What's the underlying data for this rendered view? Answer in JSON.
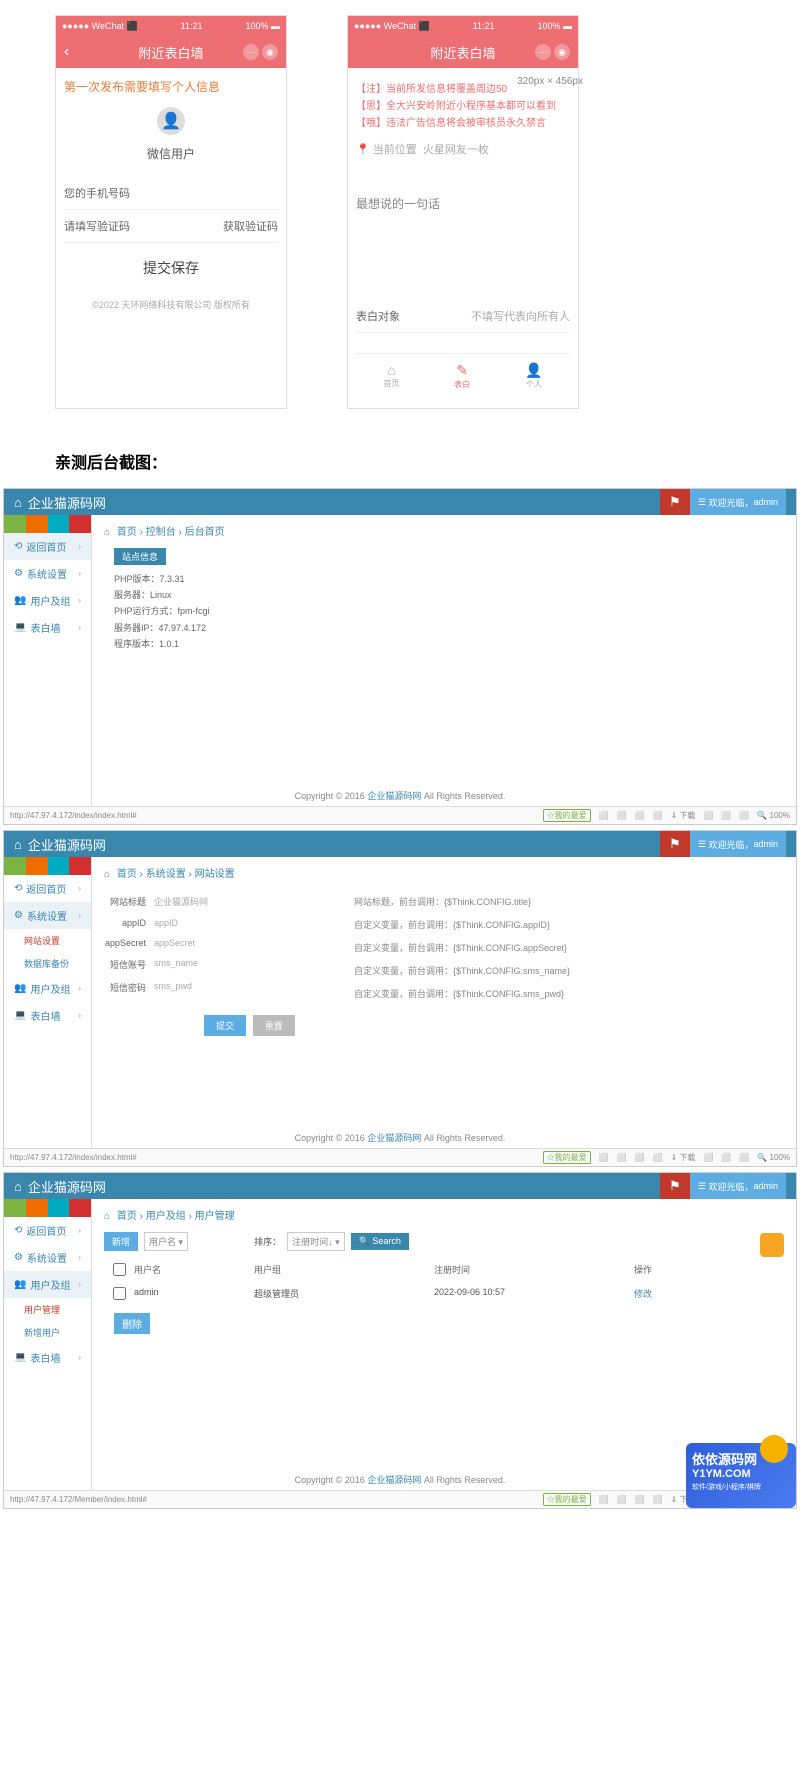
{
  "mobile_status": {
    "carrier": "●●●●● WeChat",
    "signal": "⬛",
    "time": "11:21",
    "battery": "100%",
    "icon": "▬"
  },
  "mobile_header": {
    "title": "附近表白墙",
    "back": "‹"
  },
  "mobile1": {
    "notice": "第一次发布需要填写个人信息",
    "avatar": "👤",
    "username": "微信用户",
    "phone_label": "您的手机号码",
    "code_label": "请填写验证码",
    "code_btn": "获取验证码",
    "submit": "提交保存",
    "copyright": "©2022 天环网络科技有限公司 版权所有"
  },
  "mobile2": {
    "dimension": "320px × 456px",
    "notes": [
      {
        "tag": "【注】",
        "txt": "当前所发信息将覆盖周边50"
      },
      {
        "tag": "【思】",
        "txt": "全大兴安岭附近小程序基本都可以看到"
      },
      {
        "tag": "【哦】",
        "txt": "违法广告信息将会被审核员永久禁言"
      }
    ],
    "loc_icon": "📍",
    "loc_label": "当前位置",
    "loc_val": "火星网友一枚",
    "say_label": "最想说的一句话",
    "target_label": "表白对象",
    "target_placeholder": "不填写代表向所有人",
    "tabs": [
      {
        "icon": "⌂",
        "label": "首页"
      },
      {
        "icon": "✎",
        "label": "表白"
      },
      {
        "icon": "👤",
        "label": "个人"
      }
    ]
  },
  "section_title": "亲测后台截图：",
  "admin_common": {
    "brand": "企业猫源码网",
    "brand_icon": "⌂",
    "user_welcome": "欢迎光临，",
    "user_name": "admin",
    "user_icon": "☰",
    "footer_pre": "Copyright © 2016 ",
    "footer_link": "企业猫源码网",
    "footer_post": " All Rights Reserved.",
    "fav": "☆我的最爱",
    "tools": [
      "⬜",
      "⬜",
      "⬜",
      "⬜",
      "⇓ 下载",
      "⬜",
      "⬜",
      "⬜",
      "🔍 100%"
    ]
  },
  "admin1": {
    "url": "http://47.97.4.172/index/index.html#",
    "crumb": [
      "首页",
      "控制台",
      "后台首页"
    ],
    "card_tag": "站点信息",
    "info": [
      "PHP版本：7.3.31",
      "服务器：Linux",
      "PHP运行方式：fpm-fcgi",
      "服务器IP：47.97.4.172",
      "程序版本：1.0.1"
    ],
    "menu": [
      {
        "label": "返回首页",
        "icon": "⟲",
        "active": true
      },
      {
        "label": "系统设置",
        "icon": "⚙"
      },
      {
        "label": "用户及组",
        "icon": "👥"
      },
      {
        "label": "表白墙",
        "icon": "💻"
      }
    ]
  },
  "admin2": {
    "url": "http://47.97.4.172/index/index.html#",
    "crumb": [
      "首页",
      "系统设置",
      "网站设置"
    ],
    "menu": [
      {
        "label": "返回首页",
        "icon": "⟲"
      },
      {
        "label": "系统设置",
        "icon": "⚙",
        "active": true,
        "subs": [
          "网站设置",
          "数据库备份"
        ]
      },
      {
        "label": "用户及组",
        "icon": "👥"
      },
      {
        "label": "表白墙",
        "icon": "💻"
      }
    ],
    "fields_left": [
      {
        "lbl": "网站标题",
        "val": "企业猫源码网"
      },
      {
        "lbl": "appID",
        "val": "appID"
      },
      {
        "lbl": "appSecret",
        "val": "appSecret"
      },
      {
        "lbl": "短信账号",
        "val": "sms_name"
      },
      {
        "lbl": "短信密码",
        "val": "sms_pwd"
      }
    ],
    "fields_right": [
      {
        "lbl": "网站标题，前台调用：{$Think.CONFIG.title}"
      },
      {
        "lbl": "自定义变量，前台调用：{$Think.CONFIG.appID}"
      },
      {
        "lbl": "自定义变量，前台调用：{$Think.CONFIG.appSecret}"
      },
      {
        "lbl": "自定义变量，前台调用：{$Think.CONFIG.sms_name}"
      },
      {
        "lbl": "自定义变量，前台调用：{$Think.CONFIG.sms_pwd}"
      }
    ],
    "btn_submit": "提交",
    "btn_reset": "重置"
  },
  "admin3": {
    "url": "http://47.97.4.172/Member/index.html#",
    "crumb": [
      "首页",
      "用户及组",
      "用户管理"
    ],
    "menu": [
      {
        "label": "返回首页",
        "icon": "⟲"
      },
      {
        "label": "系统设置",
        "icon": "⚙"
      },
      {
        "label": "用户及组",
        "icon": "👥",
        "active": true,
        "subs": [
          "用户管理",
          "新增用户"
        ]
      },
      {
        "label": "表白墙",
        "icon": "💻"
      }
    ],
    "toolbar": {
      "add": "新增",
      "sel1": "用户名",
      "sort_lbl": "排序：",
      "sel2": "注册时间↓",
      "search": "🔍 Search"
    },
    "thead": [
      "",
      "用户名",
      "用户组",
      "注册时间",
      "操作"
    ],
    "row": {
      "name": "admin",
      "group": "超级管理员",
      "time": "2022-09-06 10:57",
      "op": "修改"
    },
    "del": "删除"
  },
  "watermark": {
    "title": "依依源码网",
    "url": "Y1YM.COM",
    "sub": "软件/游戏/小程序/棋牌"
  }
}
